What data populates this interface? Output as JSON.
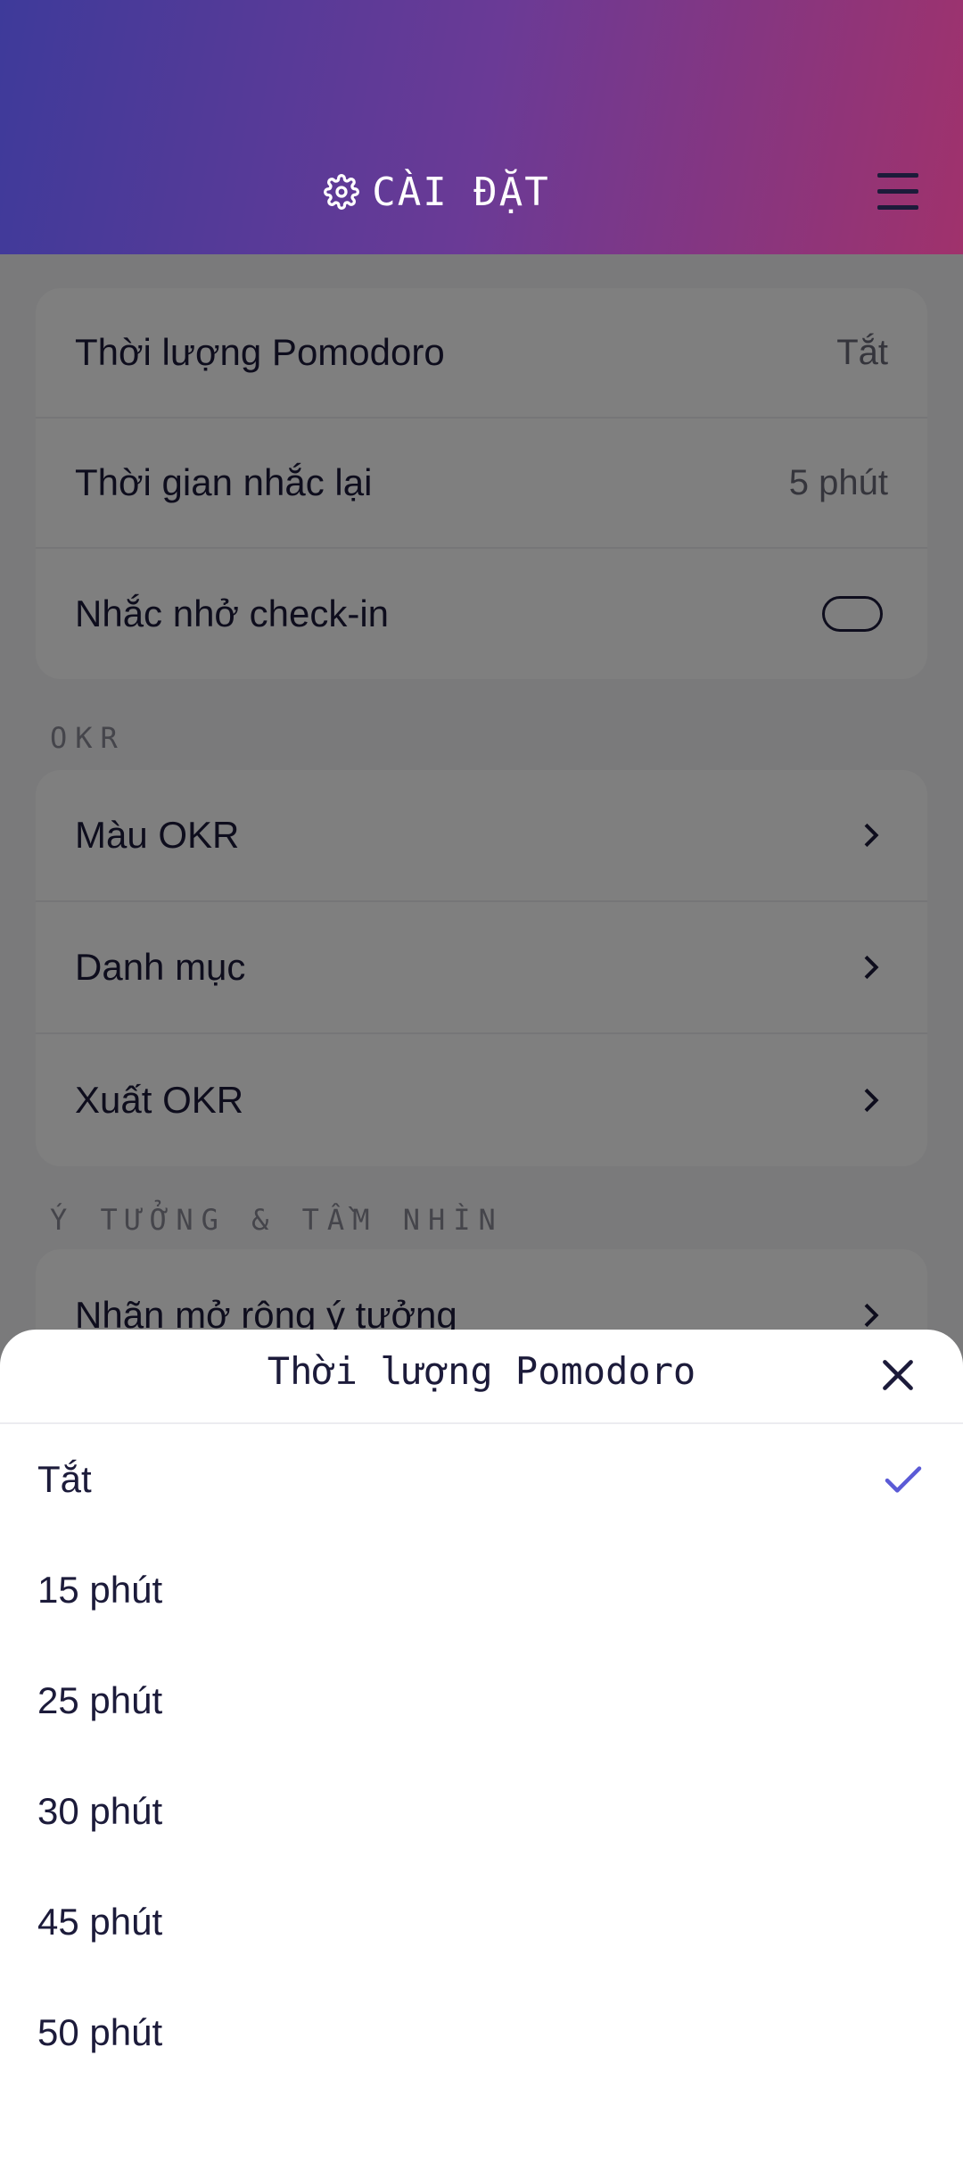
{
  "header": {
    "title": "CÀI ĐẶT",
    "title_icon": "gear-icon",
    "menu_icon": "hamburger-menu-icon"
  },
  "settings": {
    "pomodoro_section": {
      "rows": [
        {
          "label": "Thời lượng Pomodoro",
          "value": "Tắt"
        },
        {
          "label": "Thời gian nhắc lại",
          "value": "5 phút"
        },
        {
          "label": "Nhắc nhở check-in",
          "toggle": "off"
        }
      ]
    },
    "okr_section": {
      "title": "OKR",
      "rows": [
        {
          "label": "Màu OKR"
        },
        {
          "label": "Danh mục"
        },
        {
          "label": "Xuất OKR"
        }
      ]
    },
    "ideas_section": {
      "title": "Ý TƯỞNG & TẦM NHÌN",
      "rows": [
        {
          "label": "Nhãn mở rộng ý tưởng"
        }
      ]
    }
  },
  "sheet": {
    "title": "Thời lượng Pomodoro",
    "close_icon": "close-icon",
    "selected": "Tắt",
    "options": [
      "Tắt",
      "15 phút",
      "25 phút",
      "30 phút",
      "45 phút",
      "50 phút"
    ]
  },
  "colors": {
    "accent": "#5b5bd6",
    "header_start": "#3e3a9a",
    "header_end": "#a0326c",
    "text": "#1c1b3a"
  }
}
